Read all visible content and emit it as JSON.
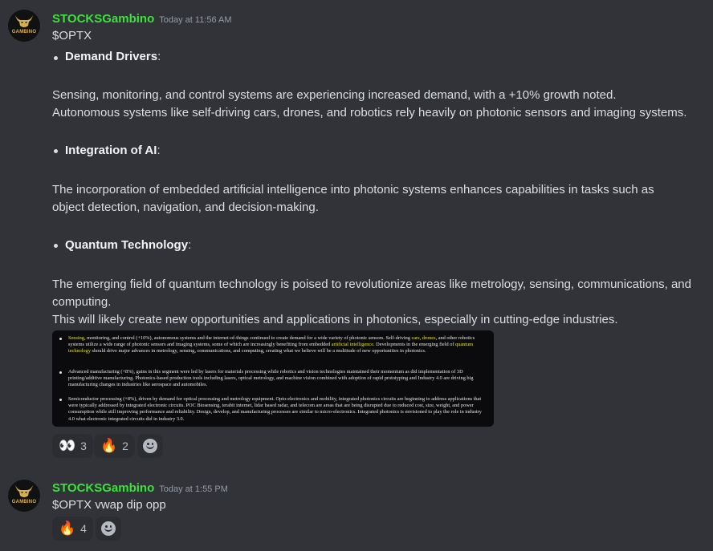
{
  "messages": [
    {
      "username": "STOCKSGambino",
      "timestamp": "Today at 11:56 AM",
      "avatar_text": "GAMBINO",
      "ticker": "$OPTX",
      "sections": [
        {
          "heading": "Demand Drivers",
          "paragraphs": [
            "Sensing, monitoring, and control systems are experiencing increased demand, with a +10% growth noted.",
            "Autonomous systems like self-driving cars, drones, and robotics rely heavily on photonic sensors and imaging systems."
          ]
        },
        {
          "heading": "Integration of AI",
          "paragraphs": [
            "The incorporation of embedded artificial intelligence into photonic systems enhances capabilities in tasks such as",
            "object detection, navigation, and decision-making."
          ]
        },
        {
          "heading": "Quantum Technology",
          "paragraphs": [
            "The emerging field of quantum technology is poised to revolutionize areas like metrology, sensing, communications, and",
            "computing.",
            "This will likely create new opportunities and applications in photonics, especially in cutting-edge industries."
          ]
        }
      ],
      "image_text": {
        "p1_a": "Sensing",
        "p1_b": ", monitoring, and control (+10%), autonomous systems and the internet-of-things continued to create demand for a wide variety of photonic sensors. Self-driving ",
        "p1_c": "cars",
        "p1_d": ", ",
        "p1_e": "drones",
        "p1_f": ", and other robotics systems utilize a wide range of photonic sensors and imaging systems, some of which are increasingly benefiting from embedded ",
        "p1_g": "artificial intelligence",
        "p1_h": ". Developments in the emerging field of ",
        "p1_i": "quantum technology",
        "p1_j": " should drive major advances in metrology, sensing, communications, and computing, creating what we believe will be a multitude of new opportunities in photonics.",
        "p2": "Advanced manufacturing (+8%), gains in this segment were led by lasers for materials processing while robotics and vision technologies maintained their momentum as did implementation of 3D printing/additive manufacturing. Photonics-based production tools including lasers, optical metrology, and machine vision combined with adoption of rapid prototyping and Industry 4.0 are driving big manufacturing changes in industries like aerospace and automobiles.",
        "p3": "Semiconductor processing (+8%), driven by demand for optical processing and metrology equipment. Opto-electronics and mobility, integrated photonics circuits are beginning to address applications that were typically addressed by integrated electronic circuits. POC Biosensing, terabit internet, lidar based radar, and telecom are areas that are being disrupted due to reduced cost, size, weight, and power consumption while still improving performance and reliability. Design, develop, and manufacturing processes are similar to micro-electronics. Integrated photonics is envisioned to play the role in industry 4.0 what electronic integrated circuits did in industry 3.0."
      },
      "reactions": [
        {
          "emoji": "👀",
          "icon": "eyes-emoji",
          "count": "3"
        },
        {
          "emoji": "🔥",
          "icon": "fire-emoji",
          "count": "2"
        }
      ]
    },
    {
      "username": "STOCKSGambino",
      "timestamp": "Today at 1:55 PM",
      "avatar_text": "GAMBINO",
      "text": "$OPTX vwap dip opp",
      "reactions": [
        {
          "emoji": "🔥",
          "icon": "fire-emoji",
          "count": "4"
        }
      ]
    }
  ],
  "colors": {
    "background": "#313338",
    "username": "#3be23b",
    "text": "#dbdee1",
    "highlight": "#e3e31f"
  }
}
